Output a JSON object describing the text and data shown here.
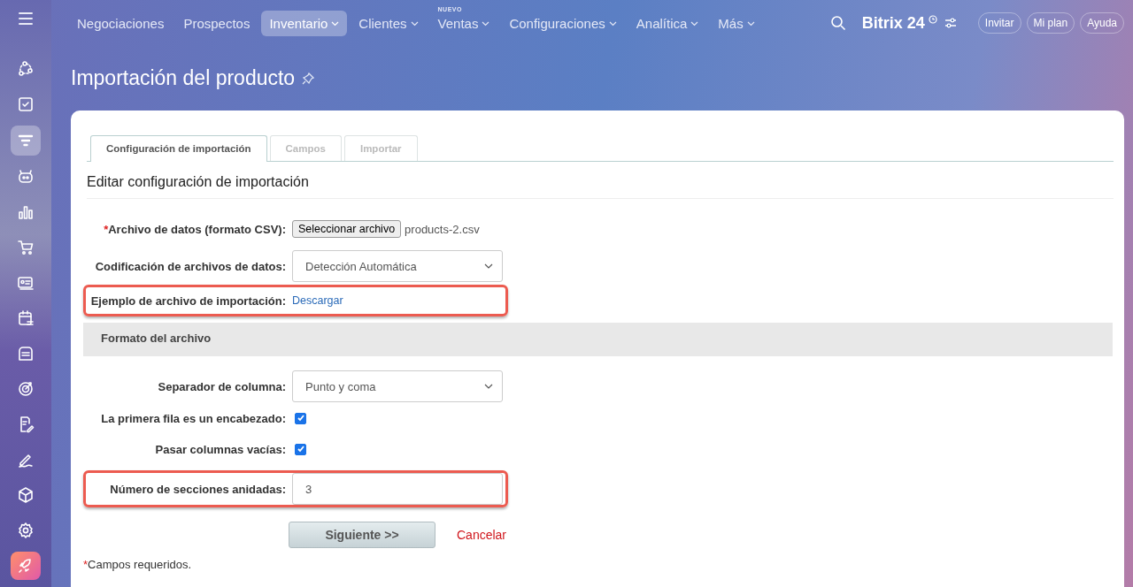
{
  "top_nav": {
    "items": [
      {
        "label": "Negociaciones",
        "selected": false,
        "dropdown": false
      },
      {
        "label": "Prospectos",
        "selected": false,
        "dropdown": false
      },
      {
        "label": "Inventario",
        "selected": true,
        "dropdown": true
      },
      {
        "label": "Clientes",
        "selected": false,
        "dropdown": true
      },
      {
        "label": "Ventas",
        "selected": false,
        "dropdown": true,
        "badge": "NUEVO"
      },
      {
        "label": "Configuraciones",
        "selected": false,
        "dropdown": true
      },
      {
        "label": "Analítica",
        "selected": false,
        "dropdown": true
      },
      {
        "label": "Más",
        "selected": false,
        "dropdown": true
      }
    ],
    "logo": "Bitrix 24",
    "buttons": [
      "Invitar",
      "Mi plan",
      "Ayuda"
    ]
  },
  "sidebar": {
    "items": [
      {
        "selected": false
      },
      {
        "selected": false
      },
      {
        "selected": true
      },
      {
        "selected": false
      },
      {
        "selected": false
      },
      {
        "selected": false
      },
      {
        "selected": false
      },
      {
        "selected": false
      },
      {
        "selected": false
      },
      {
        "selected": false
      },
      {
        "selected": false
      },
      {
        "selected": false
      },
      {
        "selected": false
      },
      {
        "selected": false
      },
      {
        "selected": false
      }
    ]
  },
  "page_title": "Importación del producto",
  "tabs": [
    {
      "label": "Configuración de importación",
      "selected": true
    },
    {
      "label": "Campos",
      "selected": false
    },
    {
      "label": "Importar",
      "selected": false
    }
  ],
  "section_title": "Editar configuración de importación",
  "form": [
    {
      "kind": "file",
      "label": "Archivo de datos (formato CSV):",
      "required": true,
      "highlighted": false,
      "button": "Seleccionar archivo",
      "value": "products-2.csv"
    },
    {
      "kind": "select",
      "label": "Codificación de archivos de datos:",
      "required": false,
      "highlighted": false,
      "value": "Detección Automática"
    },
    {
      "kind": "link",
      "label": "Ejemplo de archivo de importación:",
      "required": false,
      "highlighted": true,
      "value": "Descargar"
    },
    {
      "kind": "header",
      "label": "Formato del archivo"
    },
    {
      "kind": "select",
      "label": "Separador de columna:",
      "required": false,
      "highlighted": false,
      "value": "Punto y coma"
    },
    {
      "kind": "checkbox",
      "label": "La primera fila es un encabezado:",
      "required": false,
      "highlighted": false,
      "checked": true
    },
    {
      "kind": "checkbox",
      "label": "Pasar columnas vacías:",
      "required": false,
      "highlighted": false,
      "checked": true
    },
    {
      "kind": "input",
      "label": "Número de secciones anidadas:",
      "required": false,
      "highlighted": true,
      "value": "3"
    }
  ],
  "actions": {
    "next": "Siguiente >>",
    "cancel": "Cancelar"
  },
  "footnote": {
    "mark": "*",
    "text": "Campos requeridos."
  }
}
